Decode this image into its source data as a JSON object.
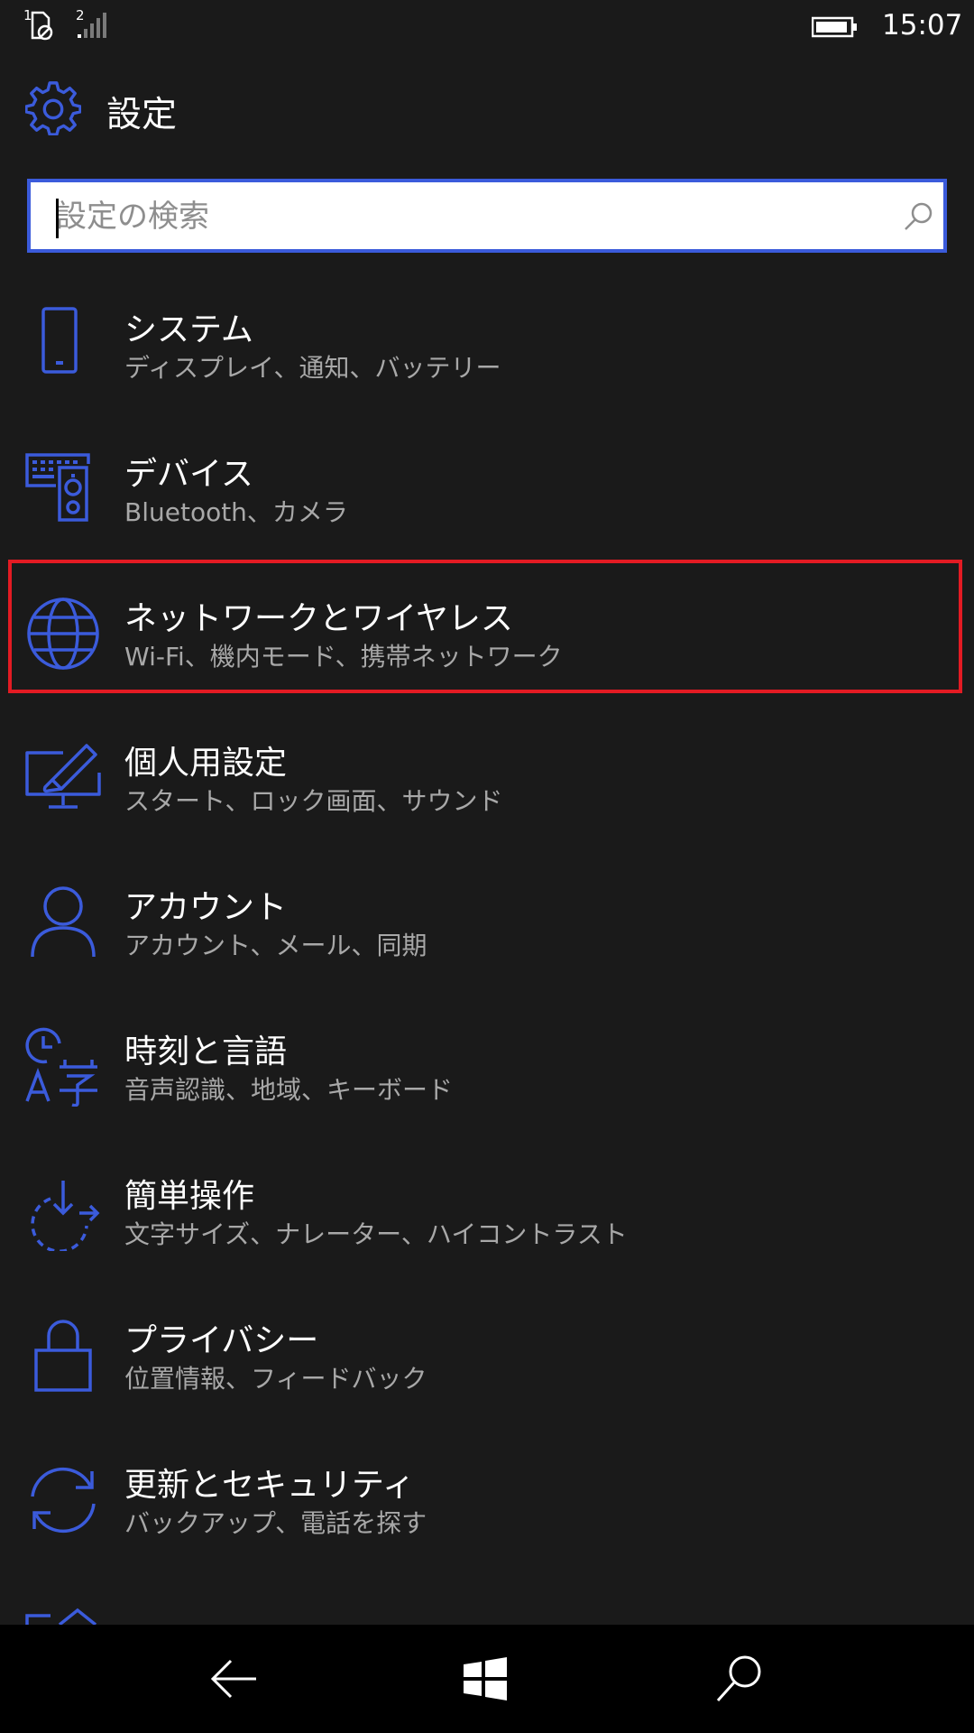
{
  "status_bar": {
    "sim1_label": "1",
    "sim2_label": "2",
    "time": "15:07",
    "sim1_icon": "no-sim-icon",
    "sim2_icon": "signal-bars-icon",
    "battery_icon": "battery-icon"
  },
  "header": {
    "title": "設定",
    "icon": "gear-icon"
  },
  "search": {
    "placeholder": "設定の検索",
    "value": "",
    "icon": "search-icon"
  },
  "settings": [
    {
      "title": "システム",
      "subtitle": "ディスプレイ、通知、バッテリー",
      "icon": "phone-icon"
    },
    {
      "title": "デバイス",
      "subtitle": "Bluetooth、カメラ",
      "icon": "devices-icon"
    },
    {
      "title": "ネットワークとワイヤレス",
      "subtitle": "Wi-Fi、機内モード、携帯ネットワーク",
      "icon": "globe-icon"
    },
    {
      "title": "個人用設定",
      "subtitle": "スタート、ロック画面、サウンド",
      "icon": "personalization-icon"
    },
    {
      "title": "アカウント",
      "subtitle": "アカウント、メール、同期",
      "icon": "person-icon"
    },
    {
      "title": "時刻と言語",
      "subtitle": "音声認識、地域、キーボード",
      "icon": "time-language-icon"
    },
    {
      "title": "簡単操作",
      "subtitle": "文字サイズ、ナレーター、ハイコントラスト",
      "icon": "ease-of-access-icon"
    },
    {
      "title": "プライバシー",
      "subtitle": "位置情報、フィードバック",
      "icon": "lock-icon"
    },
    {
      "title": "更新とセキュリティ",
      "subtitle": "バックアップ、電話を探す",
      "icon": "sync-icon"
    }
  ],
  "highlighted_item": "ネットワークとワイヤレス",
  "navigation": {
    "back_icon": "back-arrow-icon",
    "home_icon": "windows-logo-icon",
    "search_icon": "search-icon"
  },
  "colors": {
    "background": "#1a1a1a",
    "accent": "#3b5bdb",
    "highlight": "#e31b23",
    "subtitle": "#a8a8a8",
    "navbar": "#000000"
  }
}
